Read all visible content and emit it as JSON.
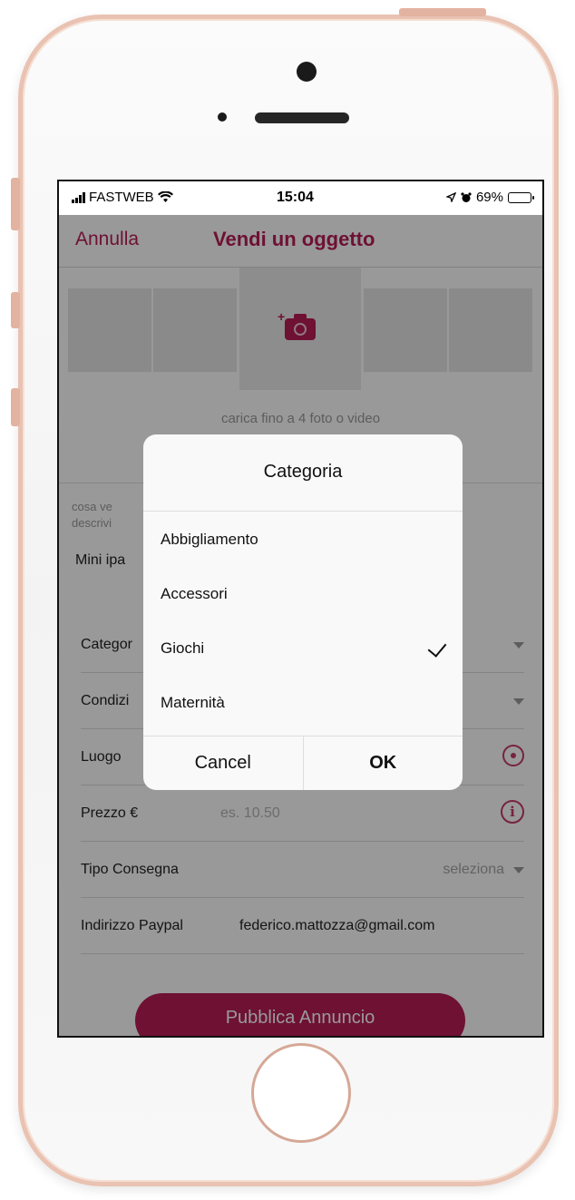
{
  "status_bar": {
    "carrier": "FASTWEB",
    "time": "15:04",
    "battery": "69%"
  },
  "nav": {
    "cancel_label": "Annulla",
    "title": "Vendi un oggetto"
  },
  "photos": {
    "hint": "carica fino a 4 foto o video"
  },
  "description": {
    "label": "cosa ve",
    "sublabel": "descrivi",
    "value": "Mini ipa"
  },
  "form": {
    "categoria_label": "Categor",
    "condizioni_label": "Condizi",
    "luogo_label": "Luogo",
    "prezzo_label": "Prezzo €",
    "prezzo_placeholder": "es. 10.50",
    "consegna_label": "Tipo Consegna",
    "consegna_value": "seleziona",
    "paypal_label": "Indirizzo Paypal",
    "paypal_value": "federico.mattozza@gmail.com"
  },
  "publish_label": "Pubblica Annuncio",
  "modal": {
    "title": "Categoria",
    "options": [
      {
        "label": "Abbigliamento",
        "selected": false
      },
      {
        "label": "Accessori",
        "selected": false
      },
      {
        "label": "Giochi",
        "selected": true
      },
      {
        "label": "Maternità",
        "selected": false
      }
    ],
    "cancel_label": "Cancel",
    "ok_label": "OK"
  },
  "colors": {
    "accent": "#b81d55",
    "phone_frame": "#e9c2b2"
  }
}
